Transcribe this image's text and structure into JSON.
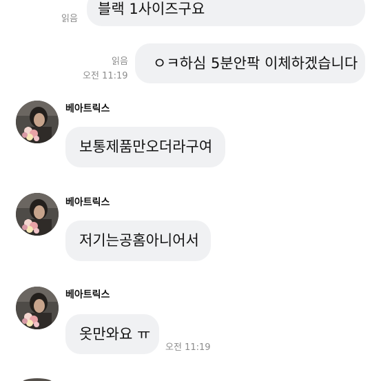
{
  "messages": {
    "m1": {
      "text": "블랙 1사이즈구요",
      "read": "읽음"
    },
    "m2": {
      "text": "ㅇㅋ하심 5분안팍 이체하겠습니다",
      "read": "읽음",
      "time": "오전 11:19"
    },
    "m3": {
      "sender": "베아트릭스",
      "text": "보통제품만오더라구여"
    },
    "m4": {
      "sender": "베아트릭스",
      "text": "저기는공홈아니어서"
    },
    "m5": {
      "sender": "베아트릭스",
      "text": "옷만와요 ㅠ",
      "time": "오전 11:19"
    }
  },
  "colors": {
    "bubble": "#f0f1f3",
    "meta_text": "#8c8c8c",
    "text": "#111111"
  }
}
